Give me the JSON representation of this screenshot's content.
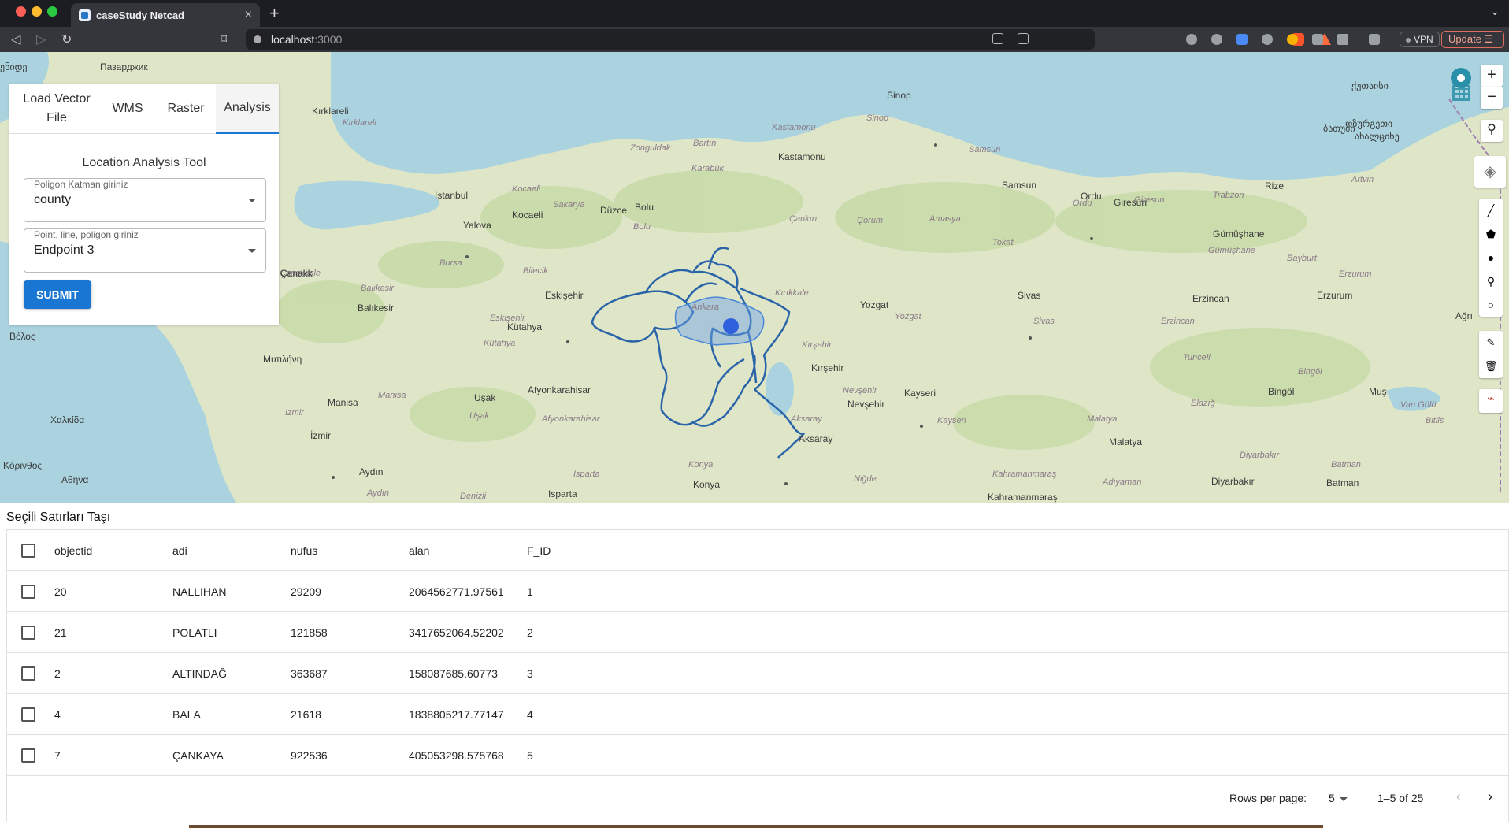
{
  "browser": {
    "tab_title": "caseStudy Netcad",
    "url_host": "localhost",
    "url_port": ":3000",
    "vpn_label": "VPN",
    "update_label": "Update"
  },
  "map": {
    "labels": [
      {
        "text": "Пазарджик"
      },
      {
        "text": "ენიდე"
      },
      {
        "text": "Kırklareli"
      },
      {
        "text": "Kırklareli"
      },
      {
        "text": "İstanbul"
      },
      {
        "text": "Yalova"
      },
      {
        "text": "Kocaeli"
      },
      {
        "text": "Kocaeli"
      },
      {
        "text": "Sakarya"
      },
      {
        "text": "Düzce"
      },
      {
        "text": "Bolu"
      },
      {
        "text": "Bolu"
      },
      {
        "text": "Zonguldak"
      },
      {
        "text": "Bartın"
      },
      {
        "text": "Karabük"
      },
      {
        "text": "Kastamonu"
      },
      {
        "text": "Kastamonu"
      },
      {
        "text": "Sinop"
      },
      {
        "text": "Sinop"
      },
      {
        "text": "Samsun"
      },
      {
        "text": "Samsun"
      },
      {
        "text": "Çankırı"
      },
      {
        "text": "Çorum"
      },
      {
        "text": "Amasya"
      },
      {
        "text": "Tokat"
      },
      {
        "text": "Ordu"
      },
      {
        "text": "Ordu"
      },
      {
        "text": "Giresun"
      },
      {
        "text": "Giresun"
      },
      {
        "text": "Trabzon"
      },
      {
        "text": "Rize"
      },
      {
        "text": "Artvin"
      },
      {
        "text": "Gümüşhane"
      },
      {
        "text": "Gümüşhane"
      },
      {
        "text": "Bayburt"
      },
      {
        "text": "Erzurum"
      },
      {
        "text": "Erzurum"
      },
      {
        "text": "Erzincan"
      },
      {
        "text": "Erzincan"
      },
      {
        "text": "Sivas"
      },
      {
        "text": "Sivas"
      },
      {
        "text": "Yozgat"
      },
      {
        "text": "Yozgat"
      },
      {
        "text": "Tunceli"
      },
      {
        "text": "Bursa"
      },
      {
        "text": "Bilecik"
      },
      {
        "text": "Eskişehir"
      },
      {
        "text": "Eskişehir"
      },
      {
        "text": "Balıkesir"
      },
      {
        "text": "Balıkesir"
      },
      {
        "text": "Kütahya"
      },
      {
        "text": "Kütahya"
      },
      {
        "text": "Ankara"
      },
      {
        "text": "Kırıkkale"
      },
      {
        "text": "Kırşehir"
      },
      {
        "text": "Kırşehir"
      },
      {
        "text": "Afyonkarahisar"
      },
      {
        "text": "Afyonkarahisar"
      },
      {
        "text": "Uşak"
      },
      {
        "text": "Uşak"
      },
      {
        "text": "Manisa"
      },
      {
        "text": "Manisa"
      },
      {
        "text": "İzmir"
      },
      {
        "text": "İzmir"
      },
      {
        "text": "Aydın"
      },
      {
        "text": "Aydın"
      },
      {
        "text": "Denizli"
      },
      {
        "text": "Isparta"
      },
      {
        "text": "Isparta"
      },
      {
        "text": "Konya"
      },
      {
        "text": "Konya"
      },
      {
        "text": "Aksaray"
      },
      {
        "text": "Aksaray"
      },
      {
        "text": "Nevşehir"
      },
      {
        "text": "Nevşehir"
      },
      {
        "text": "Niğde"
      },
      {
        "text": "Kayseri"
      },
      {
        "text": "Kayseri"
      },
      {
        "text": "Kahramanmaraş"
      },
      {
        "text": "Kahramanmaraş"
      },
      {
        "text": "Malatya"
      },
      {
        "text": "Malatya"
      },
      {
        "text": "Adıyaman"
      },
      {
        "text": "Elazığ"
      },
      {
        "text": "Bingöl"
      },
      {
        "text": "Bingöl"
      },
      {
        "text": "Muş"
      },
      {
        "text": "Bitlis"
      },
      {
        "text": "Batman"
      },
      {
        "text": "Batman"
      },
      {
        "text": "Diyarbakır"
      },
      {
        "text": "Diyarbakır"
      },
      {
        "text": "Van Gölü"
      },
      {
        "text": "Ağrı"
      },
      {
        "text": "Χαλκίδα"
      },
      {
        "text": "Αθήνα"
      },
      {
        "text": "Κόρινθος"
      },
      {
        "text": "Βόλος"
      },
      {
        "text": "Μυτιλήνη"
      },
      {
        "text": "Çanakkale"
      },
      {
        "text": "ქუთაისი"
      },
      {
        "text": "ბათუმი"
      },
      {
        "text": "ოზურგეთი"
      },
      {
        "text": "ახალციხე"
      },
      {
        "text": "Çanakk"
      }
    ]
  },
  "panel": {
    "tabs": [
      "Load Vector File",
      "WMS",
      "Raster",
      "Analysis"
    ],
    "tool_title": "Location Analysis Tool",
    "polygon_label": "Poligon Katman giriniz",
    "polygon_value": "county",
    "geom_label": "Point, line, poligon giriniz",
    "geom_value": "Endpoint 3",
    "submit_label": "SUBMIT"
  },
  "table": {
    "title": "Seçili Satırları Taşı",
    "columns": [
      "objectid",
      "adi",
      "nufus",
      "alan",
      "F_ID"
    ],
    "rows": [
      [
        "20",
        "NALLIHAN",
        "29209",
        "2064562771.97561",
        "1"
      ],
      [
        "21",
        "POLATLI",
        "121858",
        "3417652064.52202",
        "2"
      ],
      [
        "2",
        "ALTINDAĞ",
        "363687",
        "158087685.60773",
        "3"
      ],
      [
        "4",
        "BALA",
        "21618",
        "1838805217.77147",
        "4"
      ],
      [
        "7",
        "ÇANKAYA",
        "922536",
        "405053298.575768",
        "5"
      ]
    ],
    "rows_per_page_label": "Rows per page:",
    "rows_per_page": "5",
    "range": "1–5 of 25"
  },
  "colors": {
    "accent": "#1976d2",
    "polygon_stroke": "#2a64a8",
    "sea": "#aad3df",
    "land": "#dfe6c8"
  }
}
